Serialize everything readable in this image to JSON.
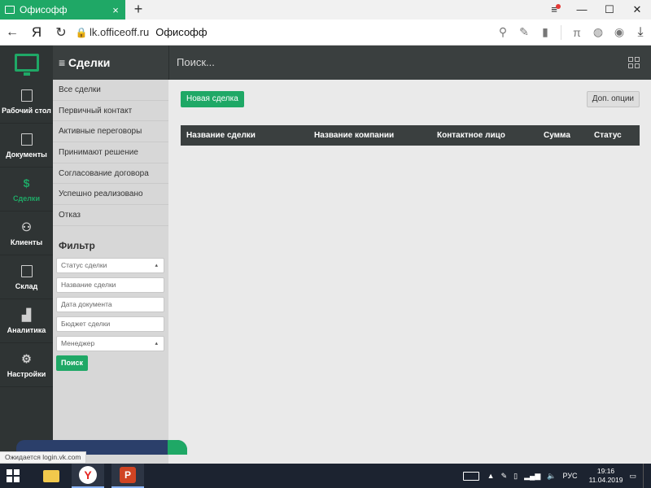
{
  "browser": {
    "tab_title": "Офисофф",
    "tab_close": "×",
    "new_tab": "+",
    "url": "lk.officeoff.ru",
    "page_title": "Офисофф",
    "status_text": "Ожидается login.vk.com"
  },
  "app": {
    "section_title": "≡ Сделки",
    "search_placeholder": "Поиск...",
    "nav": [
      {
        "label": "Рабочий стол",
        "icon": "calendar-check-icon"
      },
      {
        "label": "Документы",
        "icon": "document-icon"
      },
      {
        "label": "Сделки",
        "icon": "money-bag-icon",
        "active": true
      },
      {
        "label": "Клиенты",
        "icon": "person-icon"
      },
      {
        "label": "Склад",
        "icon": "box-icon"
      },
      {
        "label": "Аналитика",
        "icon": "bar-chart-icon"
      },
      {
        "label": "Настройки",
        "icon": "gear-icon"
      }
    ],
    "deal_stages": [
      "Все сделки",
      "Первичный контакт",
      "Активные переговоры",
      "Принимают решение",
      "Согласование договора",
      "Успешно реализовано",
      "Отказ"
    ],
    "filter": {
      "title": "Фильтр",
      "deal_status": "Статус сделки",
      "deal_name": "Название сделки",
      "doc_date": "Дата документа",
      "budget": "Бюджет сделки",
      "manager": "Менеджер",
      "search_button": "Поиск"
    },
    "main": {
      "new_deal_button": "Новая сделка",
      "more_options_button": "Доп. опции",
      "columns": [
        "Название сделки",
        "Название компании",
        "Контактное лицо",
        "Сумма",
        "Статус"
      ]
    }
  },
  "taskbar": {
    "language": "РУС",
    "time": "19:16",
    "date": "11.04.2019"
  },
  "colors": {
    "accent": "#1fa866",
    "dark": "#3a3f3f",
    "sidebar": "#2f3434"
  }
}
